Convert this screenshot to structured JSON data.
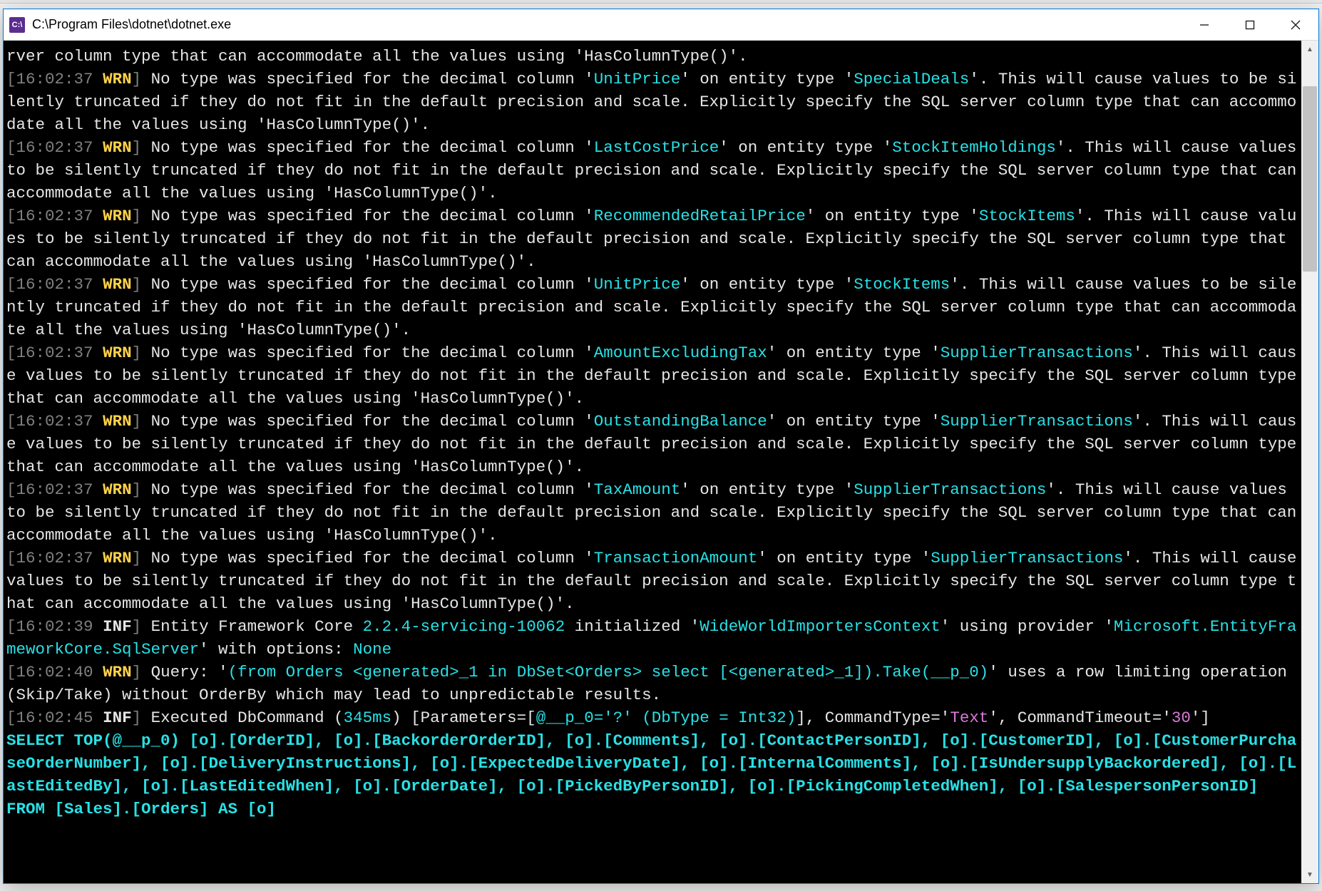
{
  "window": {
    "title": "C:\\Program Files\\dotnet\\dotnet.exe",
    "icon_label": "C:\\"
  },
  "log": {
    "timestamps": {
      "t0237": "16:02:37",
      "t0239": "16:02:39",
      "t0240": "16:02:40",
      "t0245": "16:02:45"
    },
    "levels": {
      "wrn": "WRN",
      "inf": "INF"
    },
    "fragments": {
      "tail_hascolumntype": "rver column type that can accommodate all the values using 'HasColumnType()'.",
      "no_type_prefix": " No type was specified for the decimal column '",
      "on_entity_prefix": "' on entity type '",
      "suffix_this_will_cause": "'. This will cause values to be silently truncated if they do not fit in the default precision and scale. Explicitly specify the SQL server column type that can accommodate all the values using 'HasColumnType()'.",
      "ef_init_a": " Entity Framework Core ",
      "ef_version": "2.2.4-servicing-10062",
      "ef_init_b": " initialized '",
      "ef_context": "WideWorldImportersContext",
      "ef_init_c": "' using provider '",
      "ef_provider": "Microsoft.EntityFrameworkCore.SqlServer",
      "ef_init_d": "' with options: ",
      "ef_none": "None",
      "query_a": " Query: '",
      "query_linq": "(from Orders <generated>_1 in DbSet<Orders> select [<generated>_1]).Take(__p_0)",
      "query_b": "' uses a row limiting operation (Skip/Take) without OrderBy which may lead to unpredictable results.",
      "exec_a": " Executed DbCommand (",
      "exec_ms": "345ms",
      "exec_b": ") [Parameters=[",
      "exec_param": "@__p_0='?' (DbType = Int32)",
      "exec_c": "], CommandType='",
      "exec_cmdtype": "Text",
      "exec_d": "', CommandTimeout='",
      "exec_timeout": "30",
      "exec_e": "']",
      "sql": "SELECT TOP(@__p_0) [o].[OrderID], [o].[BackorderOrderID], [o].[Comments], [o].[ContactPersonID], [o].[CustomerID], [o].[CustomerPurchaseOrderNumber], [o].[DeliveryInstructions], [o].[ExpectedDeliveryDate], [o].[InternalComments], [o].[IsUndersupplyBackordered], [o].[LastEditedBy], [o].[LastEditedWhen], [o].[OrderDate], [o].[PickedByPersonID], [o].[PickingCompletedWhen], [o].[SalespersonPersonID]\nFROM [Sales].[Orders] AS [o]"
    },
    "warnings": [
      {
        "col": "UnitPrice",
        "entity": "SpecialDeals"
      },
      {
        "col": "LastCostPrice",
        "entity": "StockItemHoldings"
      },
      {
        "col": "RecommendedRetailPrice",
        "entity": "StockItems"
      },
      {
        "col": "UnitPrice",
        "entity": "StockItems"
      },
      {
        "col": "AmountExcludingTax",
        "entity": "SupplierTransactions"
      },
      {
        "col": "OutstandingBalance",
        "entity": "SupplierTransactions"
      },
      {
        "col": "TaxAmount",
        "entity": "SupplierTransactions"
      },
      {
        "col": "TransactionAmount",
        "entity": "SupplierTransactions"
      }
    ]
  }
}
